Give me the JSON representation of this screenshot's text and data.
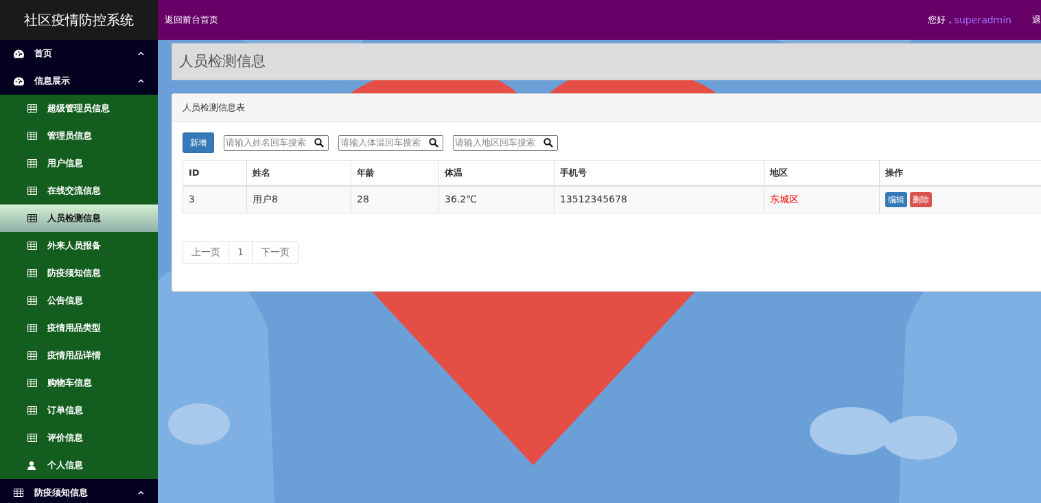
{
  "app_title": "社区疫情防控系统",
  "header": {
    "home_link": "返回前台首页",
    "greeting": "您好，",
    "username": "superadmin",
    "logout": "退"
  },
  "sidebar": {
    "groups": [
      {
        "label": "首页",
        "kind": "gauge",
        "expanded": true
      },
      {
        "label": "信息展示",
        "kind": "gauge",
        "expanded": true,
        "children": [
          {
            "label": "超级管理员信息",
            "kind": "table",
            "selected": false
          },
          {
            "label": "管理员信息",
            "kind": "table",
            "selected": false
          },
          {
            "label": "用户信息",
            "kind": "table",
            "selected": false
          },
          {
            "label": "在线交流信息",
            "kind": "table",
            "selected": false
          },
          {
            "label": "人员检测信息",
            "kind": "table",
            "selected": true
          },
          {
            "label": "外来人员报备",
            "kind": "table",
            "selected": false
          },
          {
            "label": "防疫须知信息",
            "kind": "table",
            "selected": false
          },
          {
            "label": "公告信息",
            "kind": "table",
            "selected": false
          },
          {
            "label": "疫情用品类型",
            "kind": "table",
            "selected": false
          },
          {
            "label": "疫情用品详情",
            "kind": "table",
            "selected": false
          },
          {
            "label": "购物车信息",
            "kind": "table",
            "selected": false
          },
          {
            "label": "订单信息",
            "kind": "table",
            "selected": false
          },
          {
            "label": "评价信息",
            "kind": "table",
            "selected": false
          },
          {
            "label": "个人信息",
            "kind": "user",
            "selected": false
          }
        ]
      },
      {
        "label": "防疫须知信息",
        "kind": "table",
        "expanded": true
      }
    ]
  },
  "page_title": "人员检测信息",
  "panel": {
    "title": "人员检测信息表",
    "add_button": "新增",
    "searches": [
      {
        "placeholder": "请输入姓名回车搜索"
      },
      {
        "placeholder": "请输入体温回车搜索"
      },
      {
        "placeholder": "请输入地区回车搜索"
      }
    ],
    "table": {
      "columns": [
        "ID",
        "姓名",
        "年龄",
        "体温",
        "手机号",
        "地区",
        "操作"
      ],
      "rows": [
        {
          "cells": [
            "3",
            "用户8",
            "28",
            "36.2℃",
            "13512345678",
            "东城区"
          ],
          "actions": [
            "编辑",
            "删除"
          ]
        }
      ]
    },
    "pagination": {
      "prev": "上一页",
      "pages": [
        "1"
      ],
      "next": "下一页"
    }
  }
}
